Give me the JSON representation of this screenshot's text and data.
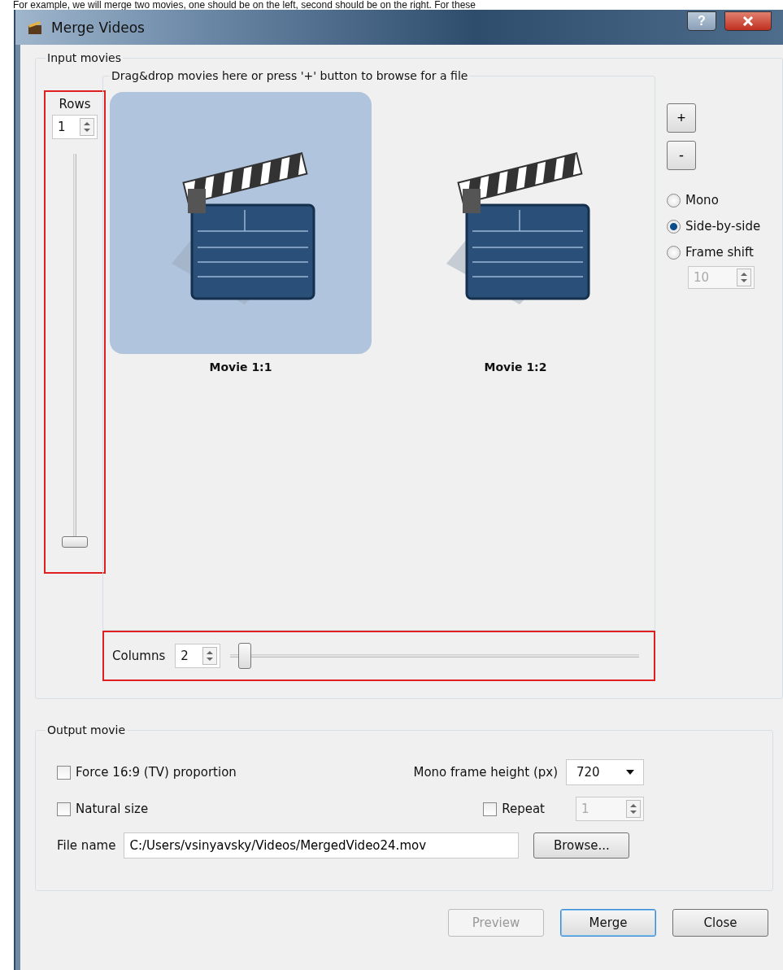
{
  "caption": "For example, we will merge two movies, one should be on the left, second should be on the right. For these",
  "window": {
    "title": "Merge Videos",
    "help_button": "?"
  },
  "input_movies": {
    "title": "Input movies",
    "rows": {
      "label": "Rows",
      "value": "1",
      "level": 0
    },
    "drop_area": {
      "title": "Drag&drop movies here or press '+' button to browse for a file",
      "movies": [
        {
          "label": "Movie 1:1",
          "selected": true
        },
        {
          "label": "Movie 1:2",
          "selected": false
        }
      ]
    },
    "columns": {
      "label": "Columns",
      "value": "2",
      "level": 0.02
    },
    "add_button": "+",
    "remove_button": "-",
    "modes": [
      {
        "label": "Mono",
        "selected": false
      },
      {
        "label": "Side-by-side",
        "selected": true
      },
      {
        "label": "Frame shift",
        "selected": false
      }
    ],
    "frame_shift": {
      "value": "10",
      "disabled": true
    }
  },
  "output_movie": {
    "title": "Output  movie",
    "force_proportion": {
      "label": "Force 16:9 (TV) proportion",
      "checked": false
    },
    "natural_size": {
      "label": "Natural size",
      "checked": false
    },
    "mono_frame_height": {
      "label": "Mono frame height (px)",
      "value": "720"
    },
    "repeat": {
      "label": "Repeat",
      "checked": false
    },
    "repeat_count": {
      "value": "1",
      "disabled": true
    },
    "file_name": {
      "label": "File name",
      "value": "C:/Users/vsinyavsky/Videos/MergedVideo24.mov"
    },
    "browse_button": "Browse..."
  },
  "buttons": [
    {
      "label": "Preview",
      "disabled": true,
      "focused": false
    },
    {
      "label": "Merge",
      "disabled": false,
      "focused": true
    },
    {
      "label": "Close",
      "disabled": false,
      "focused": false
    }
  ]
}
